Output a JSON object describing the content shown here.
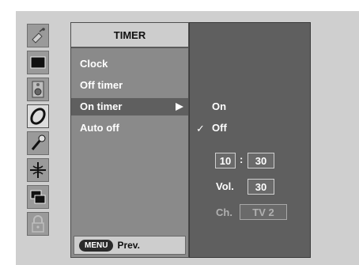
{
  "menu": {
    "title": "TIMER",
    "items": [
      {
        "label": "Clock"
      },
      {
        "label": "Off timer"
      },
      {
        "label": "On timer",
        "selected": true
      },
      {
        "label": "Auto off"
      }
    ]
  },
  "footer": {
    "menu_key": "MENU",
    "prev_label": "Prev."
  },
  "submenu": {
    "options": [
      {
        "label": "On",
        "checked": false
      },
      {
        "label": "Off",
        "checked": true
      }
    ],
    "check_mark": "✓",
    "time": {
      "hour": "10",
      "separator": ":",
      "minute": "30"
    },
    "volume": {
      "label": "Vol.",
      "value": "30"
    },
    "channel": {
      "label": "Ch.",
      "value": "TV 2"
    }
  },
  "side_icons": [
    {
      "name": "satellite-icon"
    },
    {
      "name": "screen-icon"
    },
    {
      "name": "speaker-icon"
    },
    {
      "name": "clock-icon",
      "active": true
    },
    {
      "name": "wrench-icon"
    },
    {
      "name": "pip-icon"
    },
    {
      "name": "multi-window-icon"
    },
    {
      "name": "lock-icon"
    }
  ],
  "colors": {
    "osd_background": "#cfcfcf",
    "menu_panel": "#8a8a8a",
    "submenu_panel": "#5f5f5f",
    "selected_row": "#5f5f5f"
  }
}
